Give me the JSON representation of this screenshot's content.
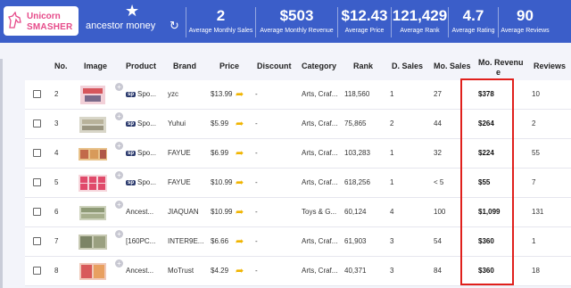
{
  "header": {
    "logo_line1": "Unicorn",
    "logo_line2": "SMASHER",
    "keyword": "ancestor money",
    "stats": [
      {
        "value": "2",
        "label": "Average Monthly Sales"
      },
      {
        "value": "$503",
        "label": "Average Monthly Revenue"
      },
      {
        "value": "$12.43",
        "label": "Average Price"
      },
      {
        "value": "121,429",
        "label": "Average Rank"
      },
      {
        "value": "4.7",
        "label": "Average Rating"
      },
      {
        "value": "90",
        "label": "Average Reviews"
      }
    ]
  },
  "table": {
    "columns": [
      "No.",
      "Image",
      "Product",
      "Brand",
      "Price",
      "Discount",
      "Category",
      "Rank",
      "D. Sales",
      "Mo. Sales",
      "Mo. Revenu",
      "e",
      "Reviews"
    ],
    "rows": [
      {
        "no": "2",
        "sp": "sp",
        "product": "Spo...",
        "brand": "yzc",
        "price": "$13.99",
        "discount": "-",
        "category": "Arts, Craf...",
        "rank": "118,560",
        "dsales": "1",
        "msales": "27",
        "mrev": "$378",
        "reviews": "10"
      },
      {
        "no": "3",
        "sp": "sp",
        "product": "Spo...",
        "brand": "Yuhui",
        "price": "$5.99",
        "discount": "-",
        "category": "Arts, Craf...",
        "rank": "75,865",
        "dsales": "2",
        "msales": "44",
        "mrev": "$264",
        "reviews": "2"
      },
      {
        "no": "4",
        "sp": "sp",
        "product": "Spo...",
        "brand": "FAYUE",
        "price": "$6.99",
        "discount": "-",
        "category": "Arts, Craf...",
        "rank": "103,283",
        "dsales": "1",
        "msales": "32",
        "mrev": "$224",
        "reviews": "55"
      },
      {
        "no": "5",
        "sp": "sp",
        "product": "Spo...",
        "brand": "FAYUE",
        "price": "$10.99",
        "discount": "-",
        "category": "Arts, Craf...",
        "rank": "618,256",
        "dsales": "1",
        "msales": "< 5",
        "mrev": "$55",
        "reviews": "7"
      },
      {
        "no": "6",
        "sp": "",
        "product": "Ancest...",
        "brand": "JIAQUAN",
        "price": "$10.99",
        "discount": "-",
        "category": "Toys & G...",
        "rank": "60,124",
        "dsales": "4",
        "msales": "100",
        "mrev": "$1,099",
        "reviews": "131"
      },
      {
        "no": "7",
        "sp": "",
        "product": "[160PC...",
        "brand": "INTER9E...",
        "price": "$6.66",
        "discount": "-",
        "category": "Arts, Craf...",
        "rank": "61,903",
        "dsales": "3",
        "msales": "54",
        "mrev": "$360",
        "reviews": "1"
      },
      {
        "no": "8",
        "sp": "",
        "product": "Ancest...",
        "brand": "MoTrust",
        "price": "$4.29",
        "discount": "-",
        "category": "Arts, Craf...",
        "rank": "40,371",
        "dsales": "3",
        "msales": "84",
        "mrev": "$360",
        "reviews": "18"
      }
    ]
  },
  "colors": {
    "header_bg": "#3b5ec9",
    "logo_text": "#e64b8a",
    "highlight_border": "#e0201c",
    "price_arrow": "#f0b400"
  },
  "icons": {
    "star": "star-icon",
    "refresh": "refresh-icon",
    "logo": "unicorn-logo-icon",
    "arrow": "price-history-icon",
    "plus": "add-icon"
  }
}
